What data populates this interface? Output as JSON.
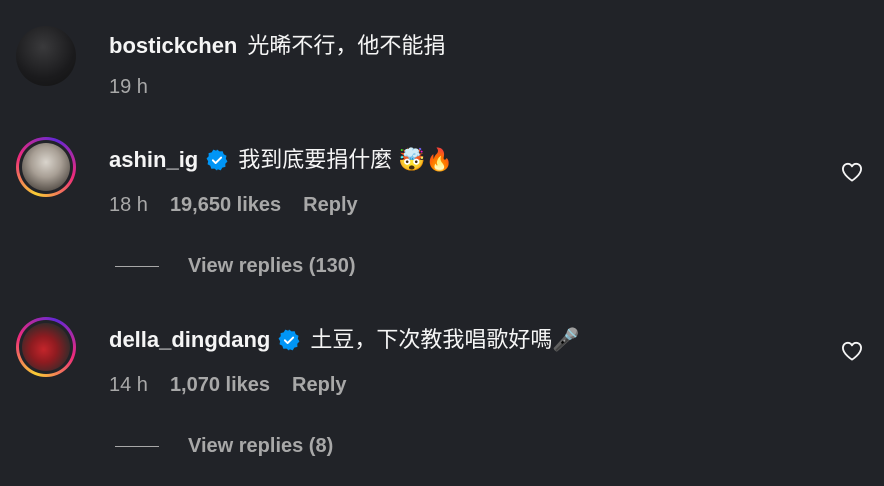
{
  "comments": [
    {
      "username": "bostickchen",
      "verified": false,
      "text": "光晞不行，他不能捐",
      "time": "19 h"
    },
    {
      "username": "ashin_ig",
      "verified": true,
      "text": "我到底要捐什麼 🤯🔥",
      "time": "18 h",
      "likes": "19,650 likes",
      "reply": "Reply",
      "view_replies": "View replies (130)"
    },
    {
      "username": "della_dingdang",
      "verified": true,
      "text": "土豆，下次教我唱歌好嗎🎤",
      "time": "14 h",
      "likes": "1,070 likes",
      "reply": "Reply",
      "view_replies": "View replies (8)"
    }
  ],
  "icons": {
    "verified": "verified-badge-icon",
    "like": "heart-icon"
  },
  "colors": {
    "background": "#212328",
    "text_primary": "#f5f5f5",
    "text_secondary": "#a8a8a8",
    "verified_blue": "#0095f6"
  }
}
